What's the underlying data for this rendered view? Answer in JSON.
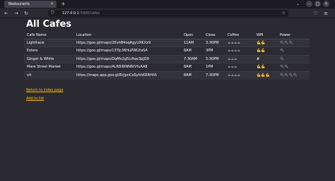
{
  "browser": {
    "tab_title": "Restaurants",
    "tab_close": "×",
    "new_tab": "+",
    "url_host": "127.0.0.1",
    "url_rest": ":5000/cafes",
    "minimize": "–",
    "maximize": "□",
    "close": "×",
    "dropdown": "⌄"
  },
  "page": {
    "title": "All Cafes",
    "columns": [
      "Cafe Name",
      "Location",
      "Open",
      "Close",
      "Coffee",
      "Wifi",
      "Power"
    ],
    "rows": [
      [
        "Lighthaus",
        "https://goo.gl/maps/2EvhB4oqAgyUXKXx9",
        "11AM",
        "3:30PM",
        "☕☕☕☕",
        "💪💪",
        "🔌🔌🔌"
      ],
      [
        "Esters",
        "https://goo.gl/maps/13Tjc36HuPWLEaSA",
        "8AM",
        "3PM",
        "☕☕☕☕",
        "💪💪",
        "🔌"
      ],
      [
        "Ginger & White",
        "https://goo.gl/maps/DqMx2g5LiAqv3pJQ9",
        "7:30AM",
        "5:30PM",
        "☕☕☕",
        "✘",
        "🔌"
      ],
      [
        "Mare Street Market",
        "https://goo.gl/maps/ALR8iBiNN6tVfuAA8",
        "8AM",
        "1PM",
        "☕☕☕",
        "💪💪",
        "🔌🔌"
      ],
      [
        "vit",
        "https://maps.app.goo.gl/EcJpnCoSyhhK6RHh5",
        "8AM",
        "7:30PM",
        "☕☕☕☕",
        "💪💪💪",
        "🔌🔌🔌🔌"
      ]
    ],
    "return_link": "Return to index page",
    "add_link": "Add to list"
  }
}
